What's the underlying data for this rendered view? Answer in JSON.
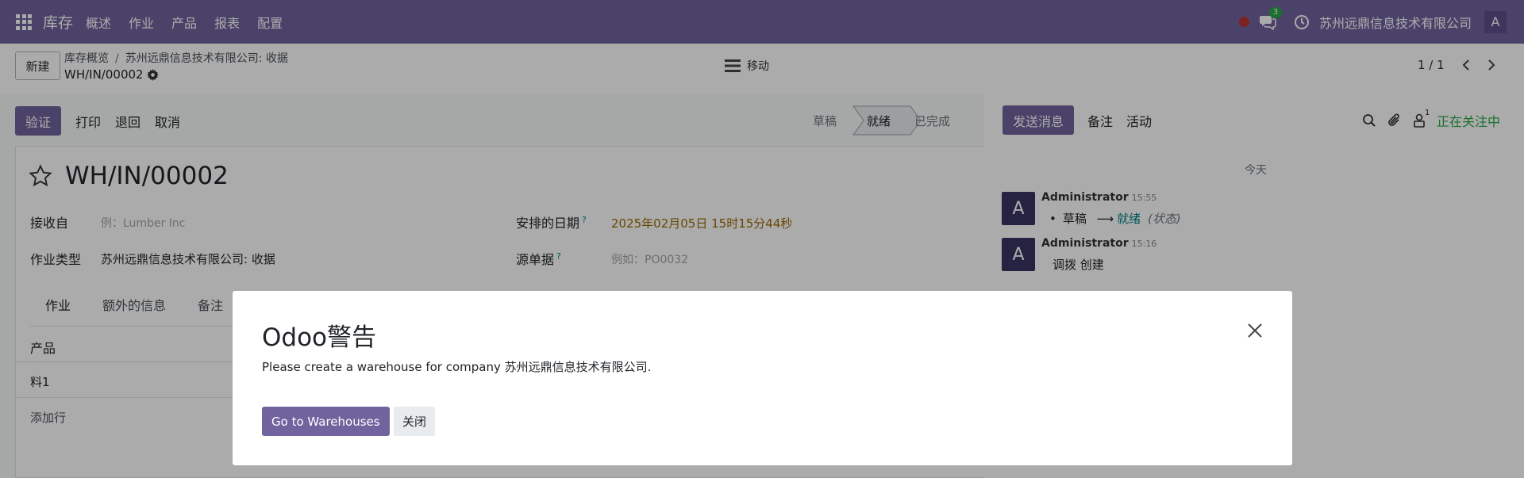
{
  "navbar": {
    "brand": "库存",
    "menu": [
      "概述",
      "作业",
      "产品",
      "报表",
      "配置"
    ],
    "chat_badge": "3",
    "company": "苏州远鼎信息技术有限公司",
    "user_initial": "A"
  },
  "control_panel": {
    "new_button": "新建",
    "breadcrumb_root": "库存概览",
    "breadcrumb_parent": "苏州远鼎信息技术有限公司: 收据",
    "record_name": "WH/IN/00002",
    "move_label": "移动",
    "pager": "1 / 1"
  },
  "actions": {
    "validate": "验证",
    "print": "打印",
    "return": "退回",
    "cancel": "取消"
  },
  "stages": {
    "draft": "草稿",
    "ready": "就绪",
    "done": "已完成"
  },
  "form": {
    "title": "WH/IN/00002",
    "receive_from_label": "接收自",
    "receive_from_placeholder": "例：Lumber Inc",
    "operation_type_label": "作业类型",
    "operation_type_value": "苏州远鼎信息技术有限公司: 收据",
    "scheduled_date_label": "安排的日期",
    "scheduled_date_help": "?",
    "scheduled_date_value": "2025年02月05日 15时15分44秒",
    "source_doc_label": "源单据",
    "source_doc_help": "?",
    "source_doc_placeholder": "例如：PO0032",
    "tabs": [
      "作业",
      "额外的信息",
      "备注"
    ],
    "product_header": "产品",
    "rows": [
      "料1"
    ],
    "add_line": "添加行"
  },
  "chatter": {
    "send_message": "发送消息",
    "log_note": "备注",
    "activity": "活动",
    "followers_count": "1",
    "following": "正在关注中",
    "today": "今天",
    "messages": [
      {
        "avatar": "A",
        "author": "Administrator",
        "time": "15:55",
        "from": "草稿",
        "arrow": "⟶",
        "to": "就绪",
        "field": "(状态)"
      },
      {
        "avatar": "A",
        "author": "Administrator",
        "time": "15:16",
        "body": "调拨 创建"
      }
    ]
  },
  "modal": {
    "title": "Odoo警告",
    "message": "Please create a warehouse for company 苏州远鼎信息技术有限公司.",
    "go_button": "Go to Warehouses",
    "close_button": "关闭"
  },
  "colors": {
    "brand": "#71639e",
    "following": "#28a745",
    "date": "#9a6b00"
  }
}
